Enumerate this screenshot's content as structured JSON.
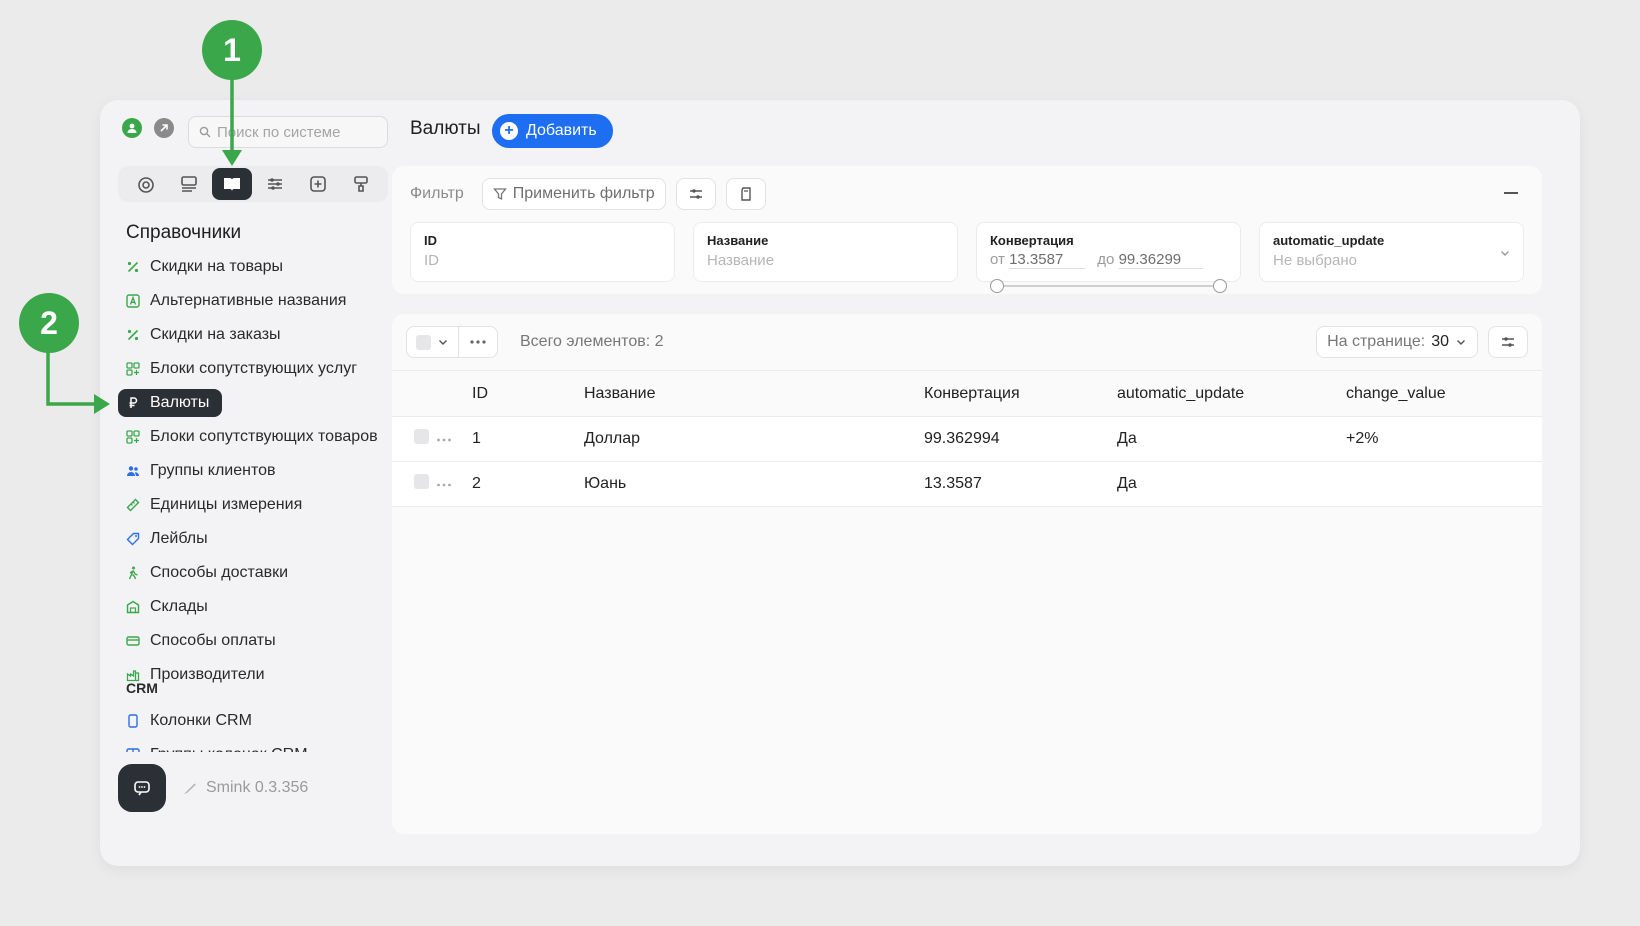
{
  "annotations": {
    "marker_1": "1",
    "marker_2": "2"
  },
  "sidebar": {
    "search_placeholder": "Поиск по системе",
    "section_title": "Справочники",
    "items": [
      {
        "label": "Скидки на товары",
        "icon": "percent-icon"
      },
      {
        "label": "Альтернативные названия",
        "icon": "letter-a-icon"
      },
      {
        "label": "Скидки на заказы",
        "icon": "percent-icon"
      },
      {
        "label": "Блоки сопутствующих услуг",
        "icon": "blocks-icon"
      },
      {
        "label": "Валюты",
        "icon": "ruble-icon"
      },
      {
        "label": "Блоки сопутствующих товаров",
        "icon": "blocks-icon"
      },
      {
        "label": "Группы клиентов",
        "icon": "users-icon"
      },
      {
        "label": "Единицы измерения",
        "icon": "ruler-icon"
      },
      {
        "label": "Лейблы",
        "icon": "tag-icon"
      },
      {
        "label": "Способы доставки",
        "icon": "walk-icon"
      },
      {
        "label": "Склады",
        "icon": "warehouse-icon"
      },
      {
        "label": "Способы оплаты",
        "icon": "card-icon"
      },
      {
        "label": "Производители",
        "icon": "factory-icon"
      }
    ],
    "crm_title": "CRM",
    "crm_items": [
      {
        "label": "Колонки CRM"
      },
      {
        "label": "Группы колонок CRM"
      }
    ],
    "version": "Smink 0.3.356"
  },
  "header": {
    "title": "Валюты",
    "add_label": "Добавить"
  },
  "filter": {
    "label": "Фильтр",
    "apply_label": "Применить фильтр",
    "fields": {
      "id": {
        "label": "ID",
        "placeholder": "ID"
      },
      "name": {
        "label": "Название",
        "placeholder": "Название"
      },
      "conversion": {
        "label": "Конвертация",
        "from_label": "от",
        "from_value": "13.3587",
        "to_label": "до",
        "to_value": "99.36299"
      },
      "auto": {
        "label": "automatic_update",
        "value": "Не выбрано"
      }
    }
  },
  "table": {
    "total_label": "Всего элементов: 2",
    "per_page_label": "На странице:",
    "per_page_value": "30",
    "columns": [
      "ID",
      "Название",
      "Конвертация",
      "automatic_update",
      "change_value"
    ],
    "rows": [
      {
        "id": "1",
        "name": "Доллар",
        "conversion": "99.362994",
        "auto": "Да",
        "change": "+2%"
      },
      {
        "id": "2",
        "name": "Юань",
        "conversion": "13.3587",
        "auto": "Да",
        "change": ""
      }
    ]
  },
  "colors": {
    "accent": "#1e6ef2",
    "active": "#2b2f36",
    "marker": "#3aa84a"
  }
}
